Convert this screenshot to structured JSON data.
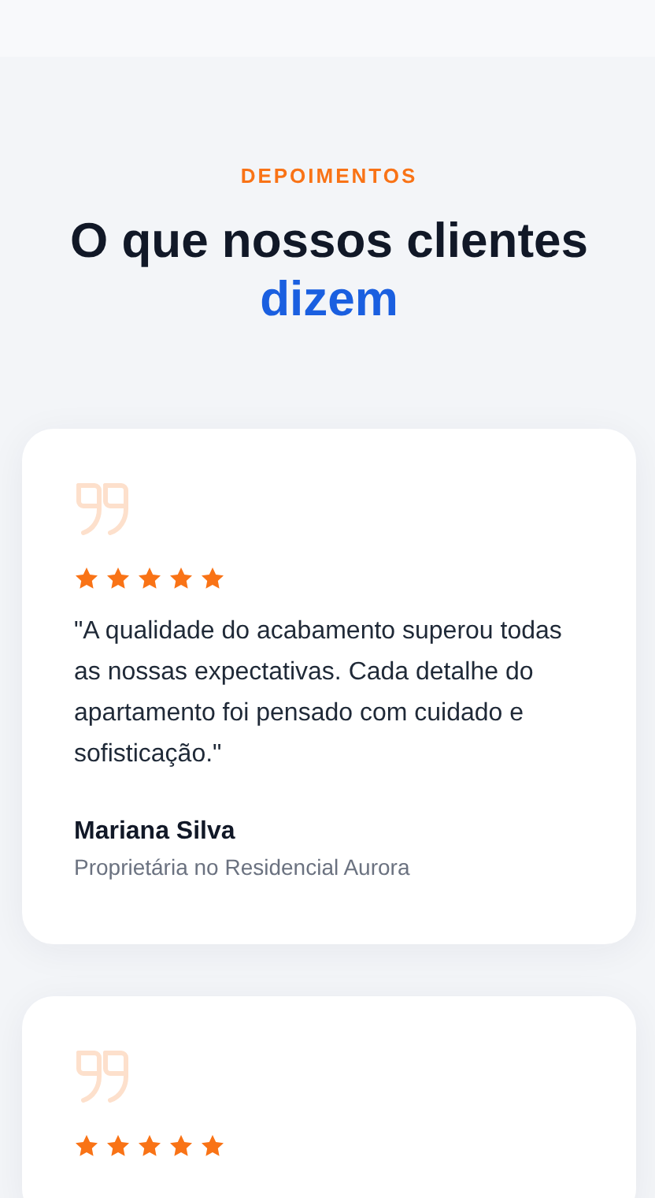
{
  "section": {
    "eyebrow": "DEPOIMENTOS",
    "title": "O que nossos clientes",
    "title_highlight": "dizem"
  },
  "testimonials": [
    {
      "stars": 5,
      "quote": "\"A qualidade do acabamento superou todas as nossas expectativas. Cada detalhe do apartamento foi pensado com cuidado e sofisticação.\"",
      "name": "Mariana Silva",
      "role": "Proprietária no Residencial Aurora"
    },
    {
      "stars": 5
    }
  ]
}
